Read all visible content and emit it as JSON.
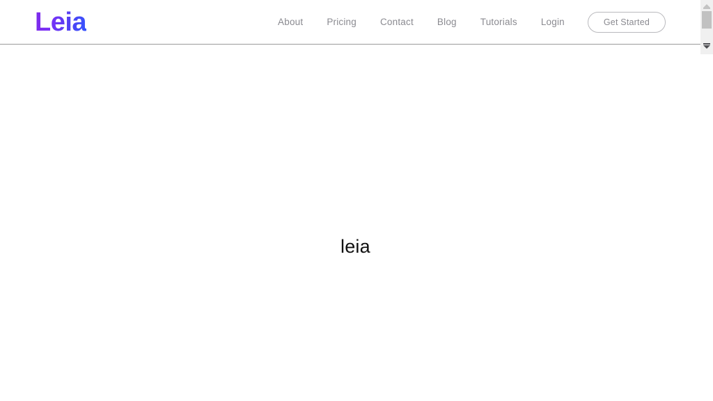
{
  "brand": {
    "logo_text": "Leia",
    "gradient_start": "#7c2ae8",
    "gradient_end": "#3355ff"
  },
  "header": {
    "nav_items": [
      {
        "label": "About"
      },
      {
        "label": "Pricing"
      },
      {
        "label": "Contact"
      },
      {
        "label": "Blog"
      },
      {
        "label": "Tutorials"
      },
      {
        "label": "Login"
      }
    ],
    "cta_label": "Get Started",
    "nav_text_color": "#8a8a90",
    "border_color": "#9a9a9a"
  },
  "main": {
    "heading": "leia",
    "background_color": "#ffffff",
    "heading_color": "#111111"
  },
  "scrollbar": {
    "up_arrow_icon": "triangle-up-icon",
    "down_arrow_icon": "triangle-down-icon",
    "thumb_color": "#c1c1c1",
    "track_color": "#f0f0f0"
  }
}
